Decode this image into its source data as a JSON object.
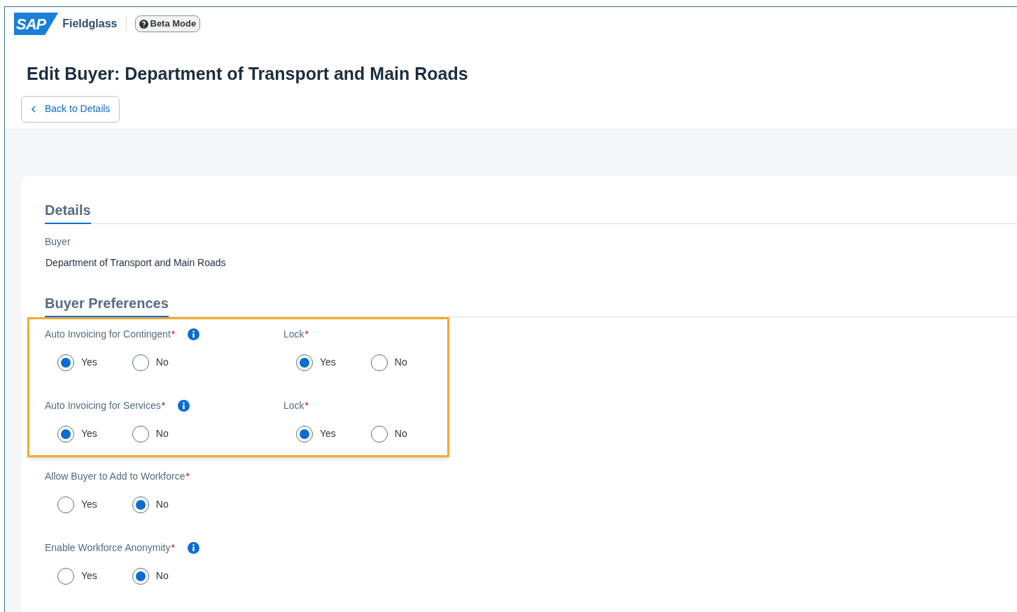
{
  "header": {
    "logo": "SAP",
    "product": "Fieldglass",
    "badge": "Beta Mode"
  },
  "page_title": "Edit Buyer: Department of Transport and Main Roads",
  "back_button": "Back to Details",
  "details": {
    "heading": "Details",
    "label": "Buyer",
    "value": "Department of Transport and Main Roads"
  },
  "preferences": {
    "heading": "Buyer Preferences",
    "highlighted_rows": [
      [
        {
          "label": "Auto Invoicing for Contingent",
          "required_mark": "*",
          "info": true,
          "options": [
            {
              "label": "Yes",
              "selected": true
            },
            {
              "label": "No",
              "selected": false
            }
          ]
        },
        {
          "label": "Lock",
          "required_mark": "*",
          "info": false,
          "options": [
            {
              "label": "Yes",
              "selected": true
            },
            {
              "label": "No",
              "selected": false
            }
          ]
        }
      ],
      [
        {
          "label": "Auto Invoicing for Services",
          "required_mark": "*",
          "info": true,
          "options": [
            {
              "label": "Yes",
              "selected": true
            },
            {
              "label": "No",
              "selected": false
            }
          ]
        },
        {
          "label": "Lock",
          "required_mark": "*",
          "info": false,
          "options": [
            {
              "label": "Yes",
              "selected": true
            },
            {
              "label": "No",
              "selected": false
            }
          ]
        }
      ]
    ],
    "fields": [
      {
        "label": "Allow Buyer to Add to Workforce",
        "required_mark": "*",
        "info": false,
        "options": [
          {
            "label": "Yes",
            "selected": false
          },
          {
            "label": "No",
            "selected": true
          }
        ]
      },
      {
        "label": "Enable Workforce Anonymity",
        "required_mark": "*",
        "info": true,
        "options": [
          {
            "label": "Yes",
            "selected": false
          },
          {
            "label": "No",
            "selected": true
          }
        ]
      }
    ]
  }
}
